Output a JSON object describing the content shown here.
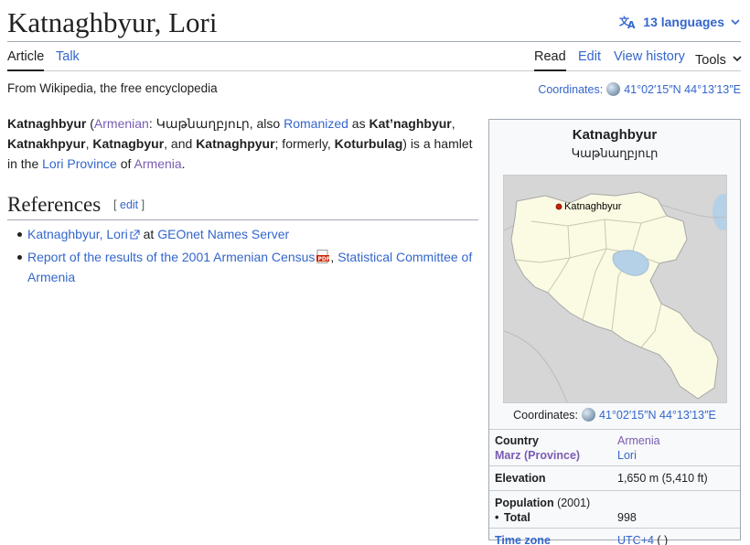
{
  "header": {
    "title": "Katnaghbyur, Lori",
    "languages_label": "13 languages"
  },
  "tabs": {
    "article": "Article",
    "talk": "Talk",
    "read": "Read",
    "edit": "Edit",
    "history": "View history",
    "tools": "Tools"
  },
  "tagline": "From Wikipedia, the free encyclopedia",
  "coords": {
    "label": "Coordinates:",
    "value": "41°02′15″N 44°13′13″E"
  },
  "lead": {
    "name": "Katnaghbyur",
    "lang_link": "Armenian",
    "native": "Կաթնաղբյուր",
    "also": ", also ",
    "romanized_link": "Romanized",
    "as": " as ",
    "alt1": "Kat’naghbyur",
    "alt2": "Katnakhpyur",
    "alt3": "Katnagbyur",
    "alt4": "Katnaghpyur",
    "formerly": "; formerly, ",
    "former": "Koturbulag",
    "tail1": ") is a hamlet in the ",
    "province_link": "Lori Province",
    "of": " of ",
    "country_link": "Armenia"
  },
  "references": {
    "title": "References",
    "edit_label": "edit",
    "items": [
      {
        "link": "Katnaghbyur, Lori",
        "mid": " at ",
        "link2": "GEOnet Names Server"
      },
      {
        "link": "Report of the results of the 2001 Armenian Census",
        "mid": ", ",
        "link2": "Statistical Committee of Armenia"
      }
    ]
  },
  "infobox": {
    "title": "Katnaghbyur",
    "native": "Կաթնաղբյուր",
    "map_marker_label": "Katnaghbyur",
    "rows": {
      "country_label": "Country",
      "country_value": "Armenia",
      "marz_label": "Marz (Province)",
      "marz_value": "Lori",
      "elevation_label": "Elevation",
      "elevation_value": "1,650 m (5,410 ft)",
      "population_label": "Population",
      "population_year": "(2001)",
      "total_label": "Total",
      "total_value": "998",
      "timezone_label": "Time zone",
      "timezone_value": "UTC+4",
      "timezone_suffix": " ( )"
    }
  },
  "colors": {
    "link": "#3366cc",
    "visited": "#795cb2",
    "map_land": "#fbfae3",
    "map_neighbor": "#d6d6d6",
    "map_water": "#b4d1e8",
    "marker": "#cc2200"
  }
}
